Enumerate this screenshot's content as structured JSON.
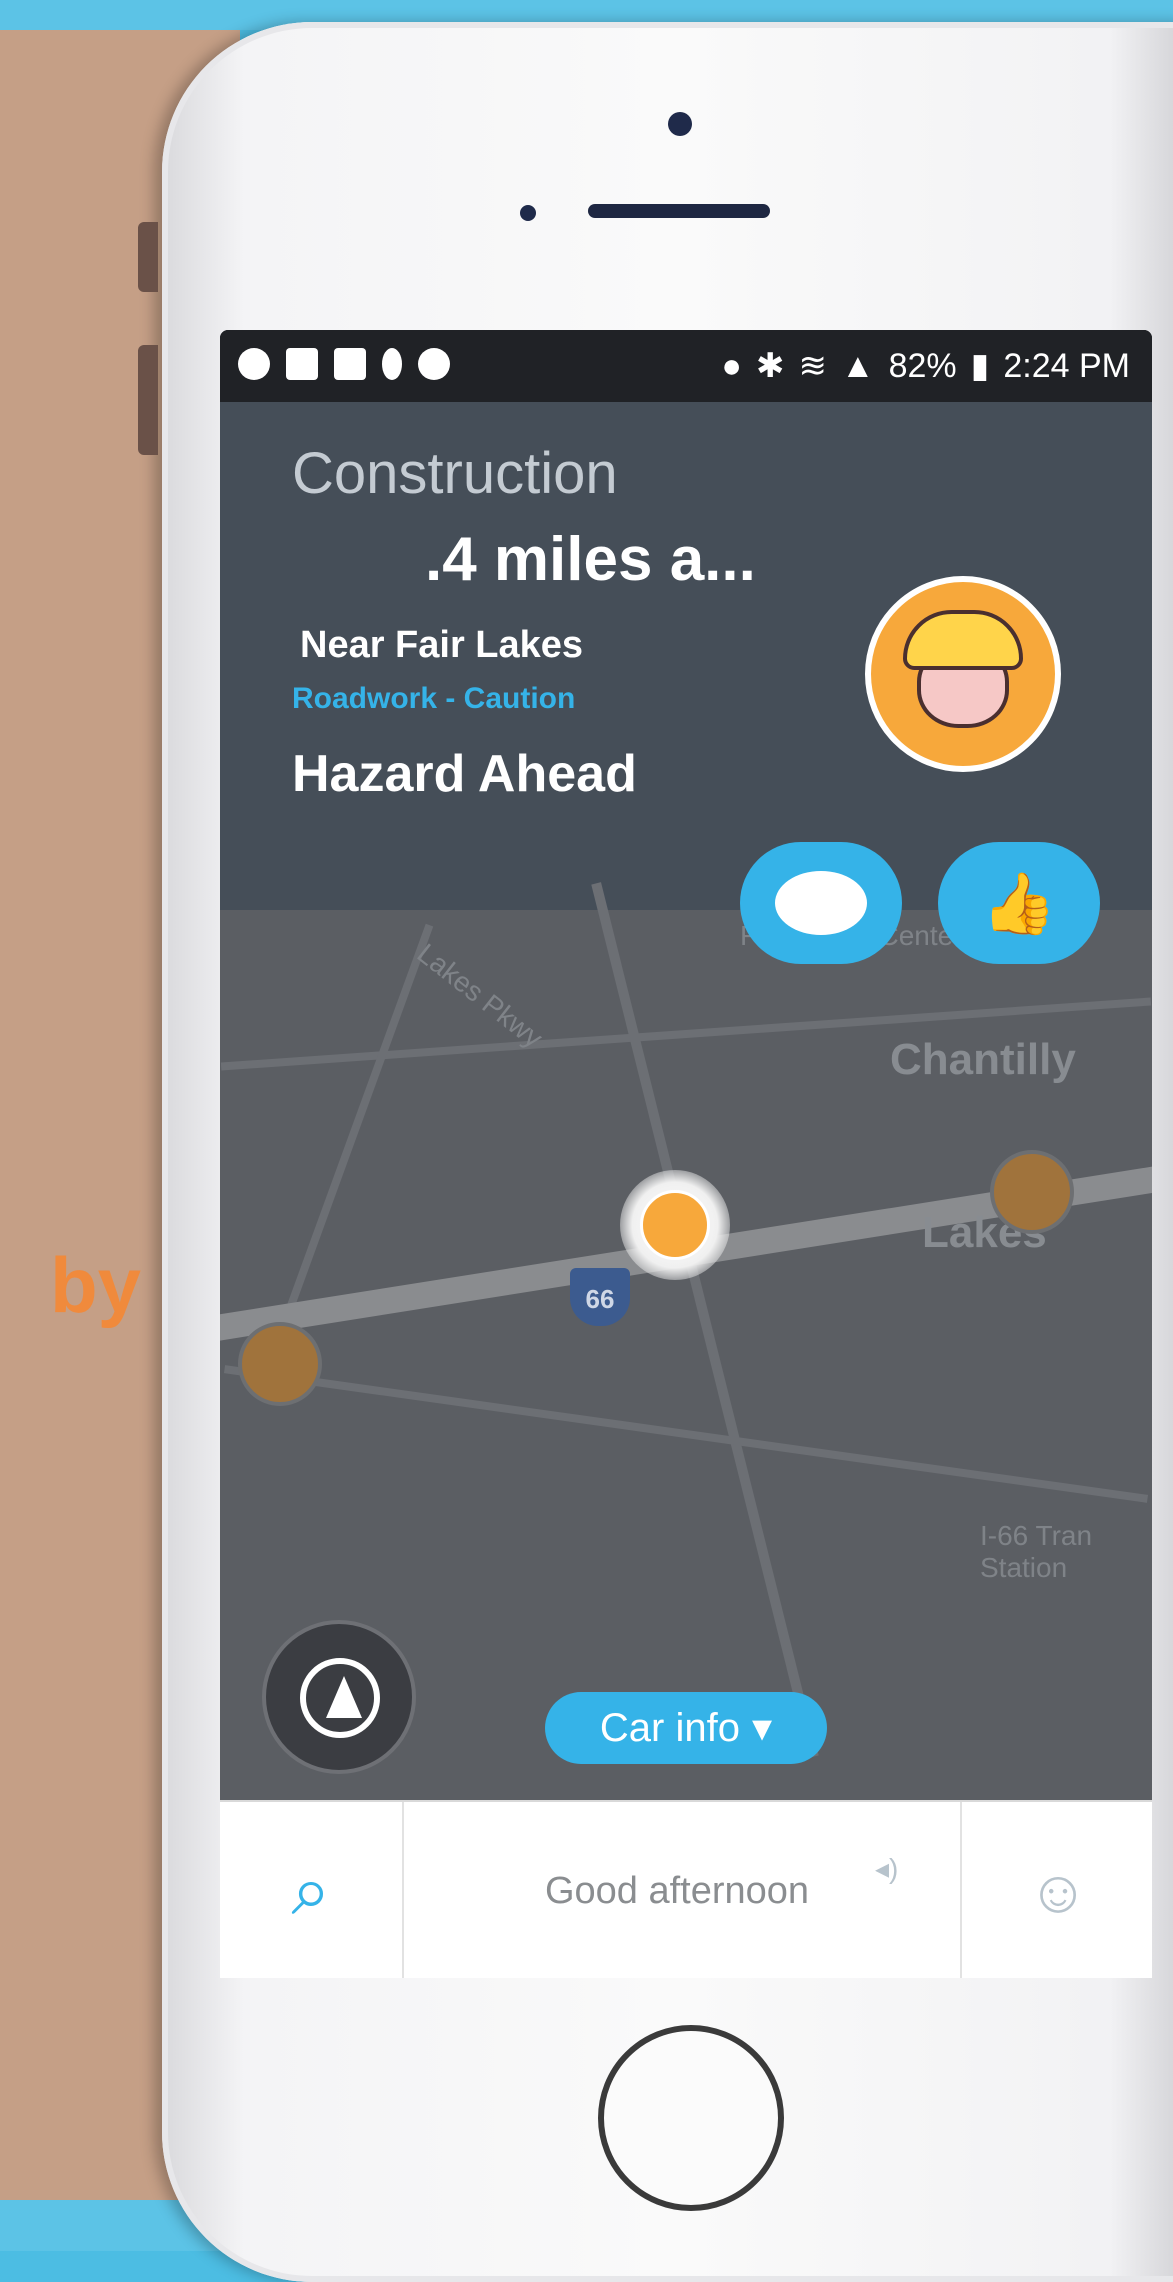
{
  "overlay_text": "by",
  "statusbar": {
    "battery": "82%",
    "time": "2:24 PM"
  },
  "alert": {
    "category": "Construction",
    "distance": ".4 miles a...",
    "location": "Near Fair Lakes",
    "type": "Roadwork - Caution",
    "title": "Hazard Ahead"
  },
  "actions": {
    "comment_icon": "comment-bubble-icon",
    "thanks_icon": "thumbs-up-icon"
  },
  "map": {
    "labels": {
      "parkway": "Lakes Pkwy",
      "fair_lakes_center": "Fair Lakes Center",
      "chantilly": "Chantilly",
      "lakes": "Lakes",
      "station": "I-66 Tran Station"
    },
    "shield": "66"
  },
  "car_info": {
    "label": "Car info"
  },
  "bottombar": {
    "greeting": "Good afternoon"
  },
  "colors": {
    "accent": "#35b3e8",
    "alert_bg": "#454e58",
    "hazard_orange": "#f7a83b"
  }
}
